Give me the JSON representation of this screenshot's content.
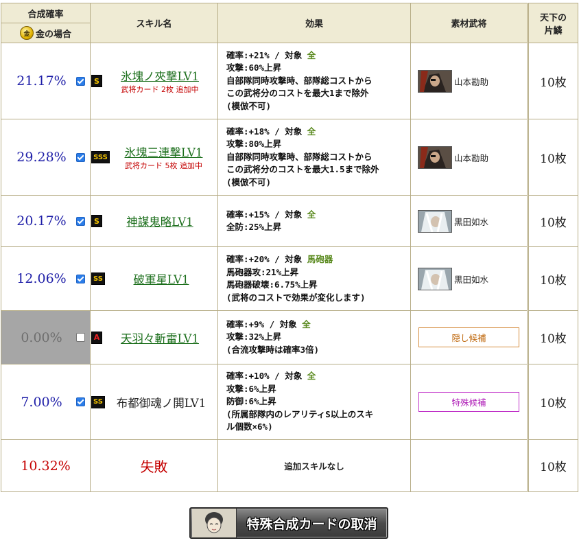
{
  "header": {
    "rate": "合成確率",
    "gold_case": "金の場合",
    "gold_icon": "金",
    "skill_name": "スキル名",
    "effect": "効果",
    "material": "素材武将",
    "scale_line1": "天下の",
    "scale_line2": "片鱗"
  },
  "rows": [
    {
      "rate": "21.17%",
      "checked": true,
      "rank": "S",
      "rank_icon": "rank-s-icon",
      "skill": "氷塊ノ夾撃LV1",
      "sub": "武将カード 2枚 追加中",
      "effect": [
        "確率:+21% / 対象 ",
        "全",
        "攻撃:60%上昇",
        "自部隊同時攻撃時、部隊総コストから",
        "この武将分のコストを最大1まで除外",
        "(模倣不可)"
      ],
      "material": "山本勘助",
      "scale": "10枚"
    },
    {
      "rate": "29.28%",
      "checked": true,
      "rank": "SSS",
      "rank_icon": "rank-sss-icon",
      "skill": "氷塊三連撃LV1",
      "sub": "武将カード 5枚 追加中",
      "effect": [
        "確率:+18% / 対象 ",
        "全",
        "攻撃:80%上昇",
        "自部隊同時攻撃時、部隊総コストから",
        "この武将分のコストを最大1.5まで除外",
        "(模倣不可)"
      ],
      "material": "山本勘助",
      "scale": "10枚"
    },
    {
      "rate": "20.17%",
      "checked": true,
      "rank": "S",
      "rank_icon": "rank-s-icon",
      "skill": "神謀鬼略LV1",
      "effect": [
        "確率:+15% / 対象 ",
        "全",
        "全防:25%上昇"
      ],
      "material": "黒田如水",
      "scale": "10枚"
    },
    {
      "rate": "12.06%",
      "checked": true,
      "rank": "SS",
      "rank_icon": "rank-ss-icon",
      "skill": "破軍星LV1",
      "effect": [
        "確率:+20% / 対象 ",
        "馬砲器",
        "馬砲器攻:21%上昇",
        "馬砲器破壊:6.75%上昇",
        "(武将のコストで効果が変化します)"
      ],
      "material": "黒田如水",
      "scale": "10枚"
    },
    {
      "rate": "0.00%",
      "checked": false,
      "rank": "A",
      "rank_icon": "rank-a-icon",
      "skill": "天羽々斬雷LV1",
      "effect": [
        "確率:+9% / 対象 ",
        "全",
        "攻撃:32%上昇",
        "(合流攻撃時は確率3倍)"
      ],
      "candidate": "隠し候補",
      "scale": "10枚"
    },
    {
      "rate": "7.00%",
      "checked": true,
      "rank": "SS",
      "rank_icon": "rank-ss-icon",
      "skill": "布都御魂ノ閧LV1",
      "effect": [
        "確率:+10% / 対象 ",
        "全",
        "攻撃:6%上昇",
        "防御:6%上昇",
        "(所属部隊内のレアリティS以上のスキ",
        "ル個数×6%)"
      ],
      "candidate": "特殊候補",
      "scale": "10枚"
    }
  ],
  "fail_row": {
    "rate": "10.32%",
    "label": "失敗",
    "effect": "追加スキルなし",
    "scale": "10枚"
  },
  "cancel_button": "特殊合成カードの取消",
  "colors": {
    "rate_blue": "#1f1fa8",
    "fail_red": "#c40000",
    "skill_green": "#1b6e1b",
    "header_bg": "#efebd4"
  }
}
